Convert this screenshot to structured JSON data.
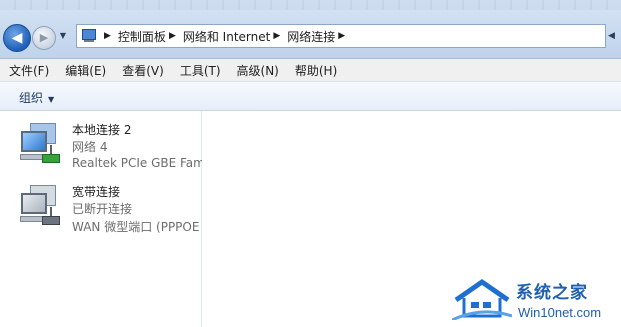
{
  "address_bar": {
    "breadcrumbs": [
      "控制面板",
      "网络和 Internet",
      "网络连接"
    ]
  },
  "menu": {
    "items": [
      "文件(F)",
      "编辑(E)",
      "查看(V)",
      "工具(T)",
      "高级(N)",
      "帮助(H)"
    ]
  },
  "command_bar": {
    "organize_label": "组织"
  },
  "connections": [
    {
      "name": "本地连接 2",
      "status": "网络  4",
      "device": "Realtek PCIe GBE Fam",
      "icon": "network-adapter-connected-icon"
    },
    {
      "name": "宽带连接",
      "status": "已断开连接",
      "device": "WAN 微型端口 (PPPOE",
      "icon": "broadband-disconnected-icon"
    }
  ],
  "watermark": {
    "title": "系统之家",
    "url": "Win10net.com"
  },
  "colors": {
    "accent": "#1f5fb8",
    "watermark": "#1f5fae"
  }
}
